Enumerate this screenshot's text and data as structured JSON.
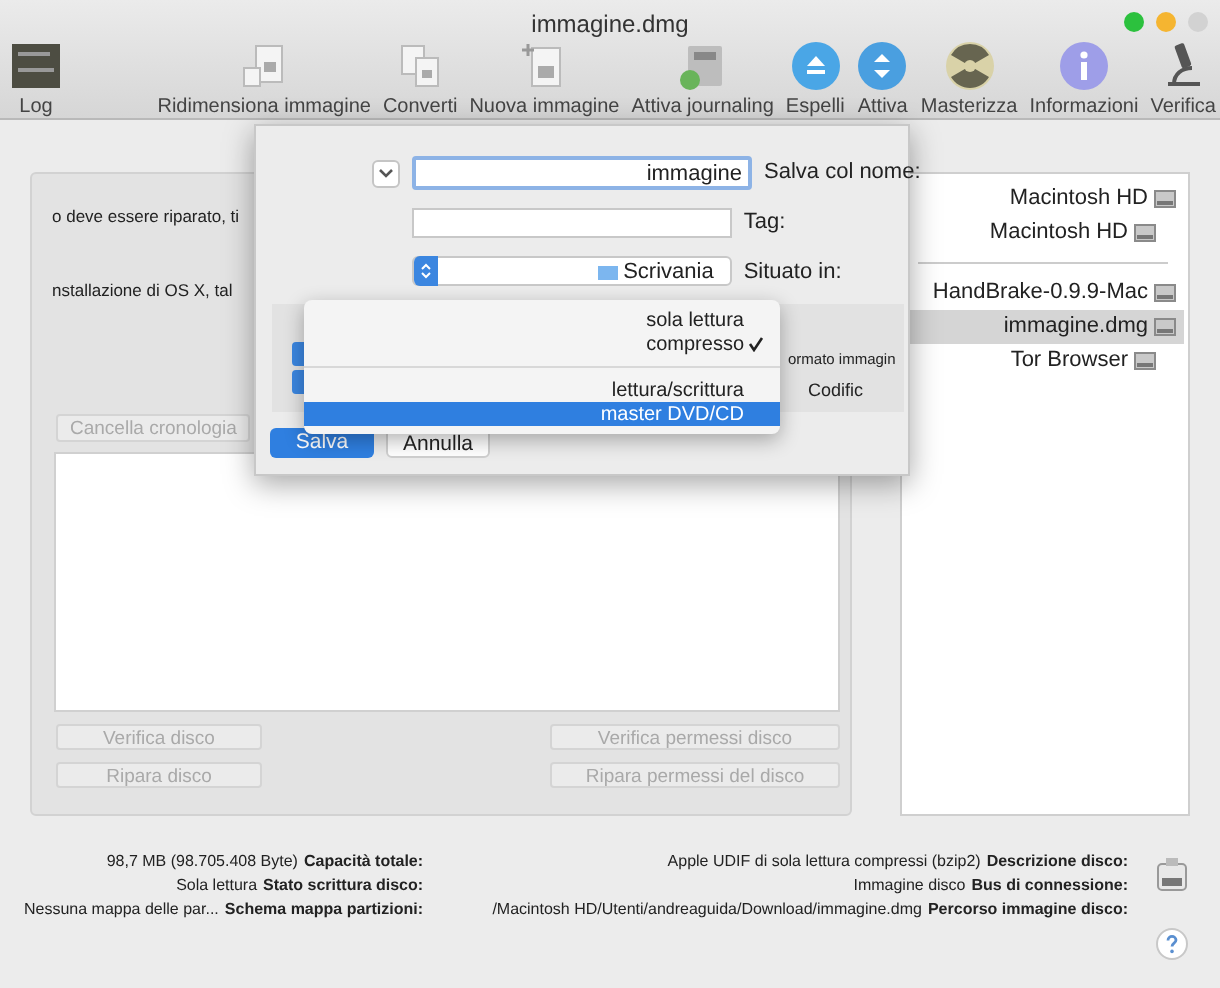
{
  "window": {
    "title": "immagine.dmg"
  },
  "toolbar": [
    {
      "label": "Ridimensiona immagine",
      "kind": "resize"
    },
    {
      "label": "Converti",
      "kind": "convert"
    },
    {
      "label": "Nuova immagine",
      "kind": "newimage"
    },
    {
      "label": "Attiva journaling",
      "kind": "journal"
    },
    {
      "label": "Espelli",
      "kind": "eject"
    },
    {
      "label": "Attiva",
      "kind": "mount"
    },
    {
      "label": "Masterizza",
      "kind": "burn"
    },
    {
      "label": "Informazioni",
      "kind": "info"
    },
    {
      "label": "Verifica",
      "kind": "microscope"
    }
  ],
  "log": {
    "label": "Log"
  },
  "sidebar": {
    "groups": [
      [
        {
          "label": "Macintosh HD",
          "selected": false,
          "children": [
            {
              "label": "Macintosh HD",
              "selected": false
            }
          ]
        }
      ],
      [
        {
          "label": "HandBrake-0.9.9-Mac",
          "selected": false
        },
        {
          "label": "immagine.dmg",
          "selected": true,
          "children": [
            {
              "label": "Tor Browser",
              "selected": false
            }
          ]
        }
      ]
    ]
  },
  "main": {
    "text_lines": [
      "o deve essere riparato, ti",
      "nstallazione di OS X, tal"
    ],
    "history_button": {
      "label": "Cancella cronologia",
      "disabled": true
    },
    "buttons": [
      {
        "label": "Verifica disco",
        "disabled": true
      },
      {
        "label": "Verifica permessi disco",
        "disabled": true
      },
      {
        "label": "Ripara disco",
        "disabled": true
      },
      {
        "label": "Ripara permessi del disco",
        "disabled": true
      }
    ]
  },
  "info": {
    "left": [
      {
        "label": "Capacità totale:",
        "value": "98,7 MB (98.705.408 Byte)"
      },
      {
        "label": "Stato scrittura disco:",
        "value": "Sola lettura"
      },
      {
        "label": "Schema mappa partizioni:",
        "value": "Nessuna mappa delle par..."
      }
    ],
    "right": [
      {
        "label": "Descrizione disco:",
        "value": "Apple UDIF di sola lettura compressi (bzip2)"
      },
      {
        "label": "Bus di connessione:",
        "value": "Immagine disco"
      },
      {
        "label": "Percorso immagine disco:",
        "value": "/Macintosh HD/Utenti/andreaguida/Download/immagine.dmg"
      }
    ]
  },
  "sheet": {
    "save_as": {
      "label": "Salva col nome:",
      "value": "immagine"
    },
    "tag": {
      "label": "Tag:"
    },
    "location": {
      "label": "Situato in:",
      "value": "Scrivania"
    },
    "format_label": "ormato immagin",
    "encryption_label": "Codific",
    "menu": [
      {
        "label": "sola lettura",
        "checked": false,
        "selected": false
      },
      {
        "label": "compresso",
        "checked": true,
        "selected": false
      },
      {
        "label": "lettura/scrittura",
        "checked": false,
        "selected": false
      },
      {
        "label": "master DVD/CD",
        "checked": false,
        "selected": true
      }
    ],
    "buttons": [
      {
        "label": "Salva",
        "default": true
      },
      {
        "label": "Annulla",
        "default": false
      }
    ]
  }
}
